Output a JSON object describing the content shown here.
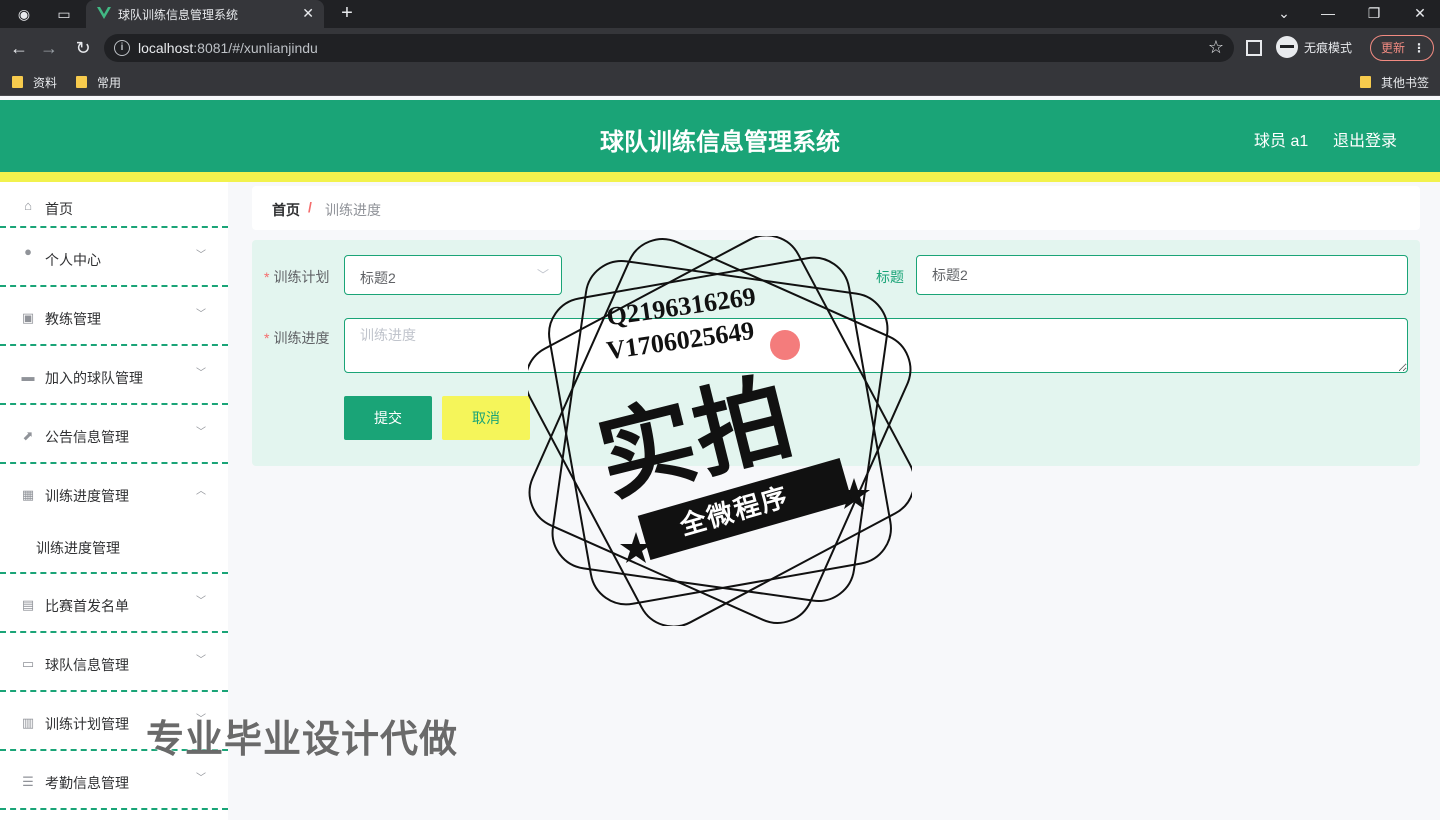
{
  "browser": {
    "tab_title": "球队训练信息管理系统",
    "url_host": "localhost",
    "url_rest": ":8081/#/xunlianjindu",
    "incognito_label": "无痕模式",
    "update_label": "更新",
    "bookmarks": [
      "资料",
      "常用"
    ],
    "other_bookmarks": "其他书签"
  },
  "header": {
    "title": "球队训练信息管理系统",
    "user": "球员 a1",
    "logout": "退出登录",
    "colors": {
      "primary": "#1aa477",
      "accent": "#f2f24d"
    }
  },
  "sidebar": {
    "items": [
      {
        "label": "首页",
        "icon": "home-icon"
      },
      {
        "label": "个人中心",
        "icon": "user-icon"
      },
      {
        "label": "教练管理",
        "icon": "clipboard-check-icon"
      },
      {
        "label": "加入的球队管理",
        "icon": "briefcase-icon"
      },
      {
        "label": "公告信息管理",
        "icon": "chart-icon"
      },
      {
        "label": "训练进度管理",
        "icon": "grid-icon"
      },
      {
        "label": "比赛首发名单",
        "icon": "clipboard-icon"
      },
      {
        "label": "球队信息管理",
        "icon": "monitor-icon"
      },
      {
        "label": "训练计划管理",
        "icon": "books-icon"
      },
      {
        "label": "考勤信息管理",
        "icon": "list-icon"
      }
    ],
    "subitem": "训练进度管理"
  },
  "breadcrumb": {
    "home": "首页",
    "separator": "/",
    "current": "训练进度"
  },
  "form": {
    "plan_label": "训练计划",
    "plan_value": "标题2",
    "title_label": "标题",
    "title_value": "标题2",
    "progress_label": "训练进度",
    "progress_placeholder": "训练进度",
    "submit": "提交",
    "cancel": "取消"
  },
  "watermark": {
    "qq": "Q2196316269",
    "vx": "V1706025649",
    "big": "实拍",
    "banner": "全微程序",
    "bottom": "专业毕业设计代做"
  }
}
